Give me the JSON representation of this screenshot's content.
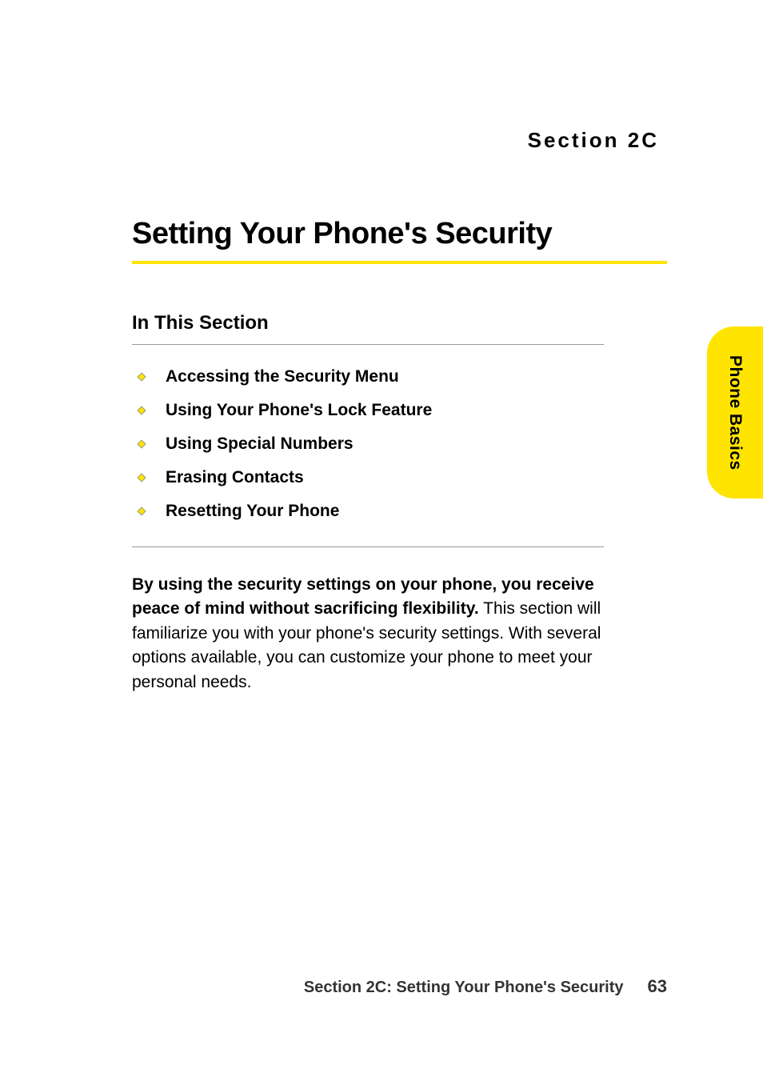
{
  "sectionLabel": "Section 2C",
  "title": "Setting Your Phone's Security",
  "subheading": "In This Section",
  "bullets": [
    "Accessing the Security Menu",
    "Using Your Phone's Lock Feature",
    "Using Special Numbers",
    "Erasing Contacts",
    "Resetting Your Phone"
  ],
  "paragraph": {
    "lead": "By using the security settings on your phone, you receive peace of mind without sacrificing flexibility.",
    "rest": " This section will familiarize you with your phone's security settings. With several options available, you can customize your phone to meet your personal needs."
  },
  "sideTab": "Phone Basics",
  "footer": {
    "text": "Section 2C: Setting Your Phone's Security",
    "page": "63"
  }
}
